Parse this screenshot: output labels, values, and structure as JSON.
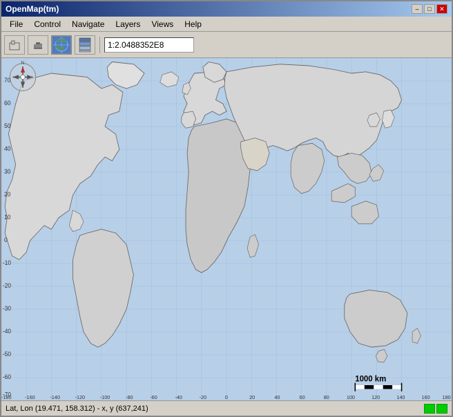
{
  "window": {
    "title": "OpenMap(tm)",
    "minimize_label": "–",
    "maximize_label": "□",
    "close_label": "✕"
  },
  "menu": {
    "items": [
      "File",
      "Control",
      "Navigate",
      "Layers",
      "Views",
      "Help"
    ]
  },
  "toolbar": {
    "scale_value": "1:2.0488352E8",
    "scale_placeholder": "Scale",
    "btn_back_icon": "←",
    "btn_hand_icon": "✋",
    "btn_map_icon": "🗺",
    "btn_layers_icon": "▦"
  },
  "status": {
    "coordinates": "Lat, Lon (19.471, 158.312) - x, y (637,241)",
    "led1": "green",
    "led2": "green"
  },
  "map": {
    "scale_text": "1000 km",
    "lat_labels": [
      "70",
      "60",
      "50",
      "40",
      "30",
      "20",
      "10",
      "0",
      "-10",
      "-20",
      "-30",
      "-40",
      "-50",
      "-60",
      "-70"
    ],
    "lon_labels": [
      "-180",
      "-160",
      "-140",
      "-120",
      "-100",
      "-80",
      "-60",
      "-40",
      "-20",
      "0",
      "20",
      "40",
      "60",
      "80",
      "100",
      "120",
      "140",
      "160",
      "180"
    ]
  }
}
